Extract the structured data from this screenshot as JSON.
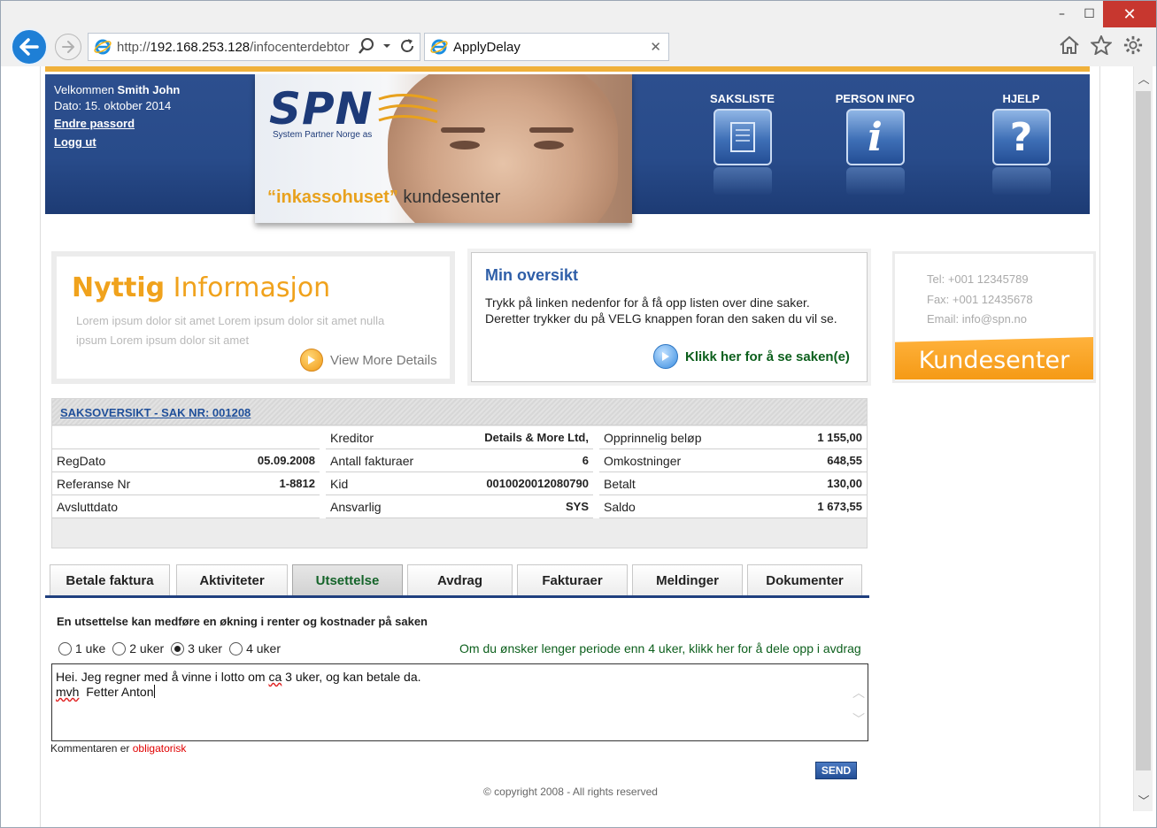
{
  "browser": {
    "url_proto": "http://",
    "url_host": "192.168.253.128",
    "url_path": "/infocenterdebtor",
    "tab_title": "ApplyDelay",
    "window_controls": [
      "–",
      "☐",
      "✕"
    ]
  },
  "header": {
    "welcome_label": "Velkommen",
    "user_name": "Smith John",
    "date_text": "Dato: 15. oktober 2014",
    "change_password": "Endre passord",
    "logout": "Logg ut",
    "logo_text": "SPN",
    "logo_sub": "System Partner Norge as",
    "tagline_quote": "“inkassohuset”",
    "tagline_rest": "kundesenter",
    "nav": [
      {
        "label": "SAKSLISTE",
        "icon": "document-icon"
      },
      {
        "label": "PERSON INFO",
        "icon": "info-icon"
      },
      {
        "label": "HJELP",
        "icon": "help-icon"
      }
    ]
  },
  "nyttig": {
    "title_a": "Nyttig",
    "title_b": "Informasjon",
    "text": "Lorem ipsum dolor sit amet Lorem ipsum dolor sit amet nulla ipsum Lorem ipsum dolor sit amet",
    "link": "View More Details"
  },
  "min_oversikt": {
    "title": "Min oversikt",
    "text": "Trykk på linken nedenfor for å få opp listen over dine saker. Deretter trykker du på VELG knappen foran den saken du vil se.",
    "link": "Klikk her for å se saken(e)"
  },
  "kundesenter": {
    "tel": "Tel: +001 12345789",
    "fax": "Fax: +001 12435678",
    "email": "Email: info@spn.no",
    "label": "Kundesenter"
  },
  "case": {
    "heading": "SAKSOVERSIKT - SAK NR: 001208",
    "col1": [
      {
        "label": "",
        "value": ""
      },
      {
        "label": "RegDato",
        "value": "05.09.2008"
      },
      {
        "label": "Referanse Nr",
        "value": "1-8812"
      },
      {
        "label": "Avsluttdato",
        "value": ""
      }
    ],
    "col2": [
      {
        "label": "Kreditor",
        "value": "Details & More Ltd,"
      },
      {
        "label": "Antall fakturaer",
        "value": "6"
      },
      {
        "label": "Kid",
        "value": "0010020012080790"
      },
      {
        "label": "Ansvarlig",
        "value": "SYS"
      }
    ],
    "col3": [
      {
        "label": "Opprinnelig beløp",
        "value": "1 155,00"
      },
      {
        "label": "Omkostninger",
        "value": "648,55"
      },
      {
        "label": "Betalt",
        "value": "130,00"
      },
      {
        "label": "Saldo",
        "value": "1 673,55"
      }
    ]
  },
  "tabs": [
    "Betale faktura",
    "Aktiviteter",
    "Utsettelse",
    "Avdrag",
    "Fakturaer",
    "Meldinger",
    "Dokumenter"
  ],
  "active_tab": "Utsettelse",
  "delay": {
    "note": "En utsettelse kan medføre en økning i renter og kostnader på saken",
    "options": [
      "1 uke",
      "2 uker",
      "3 uker",
      "4 uker"
    ],
    "selected": "3 uker",
    "split_link": "Om du ønsker lenger periode enn 4 uker, klikk her for å dele opp i avdrag",
    "comment_line1_a": "Hei. Jeg regner med å vinne i lotto om ",
    "comment_line1_sp": "ca",
    "comment_line1_b": " 3 uker, og kan betale da.",
    "comment_line2_sp": "mvh",
    "comment_line2_b": "  Fetter Anton",
    "required_text": "Kommentaren er ",
    "required_red": "obligatorisk",
    "send_label": "SEND"
  },
  "footer": {
    "copyright": "© copyright 2008 - All rights reserved"
  }
}
